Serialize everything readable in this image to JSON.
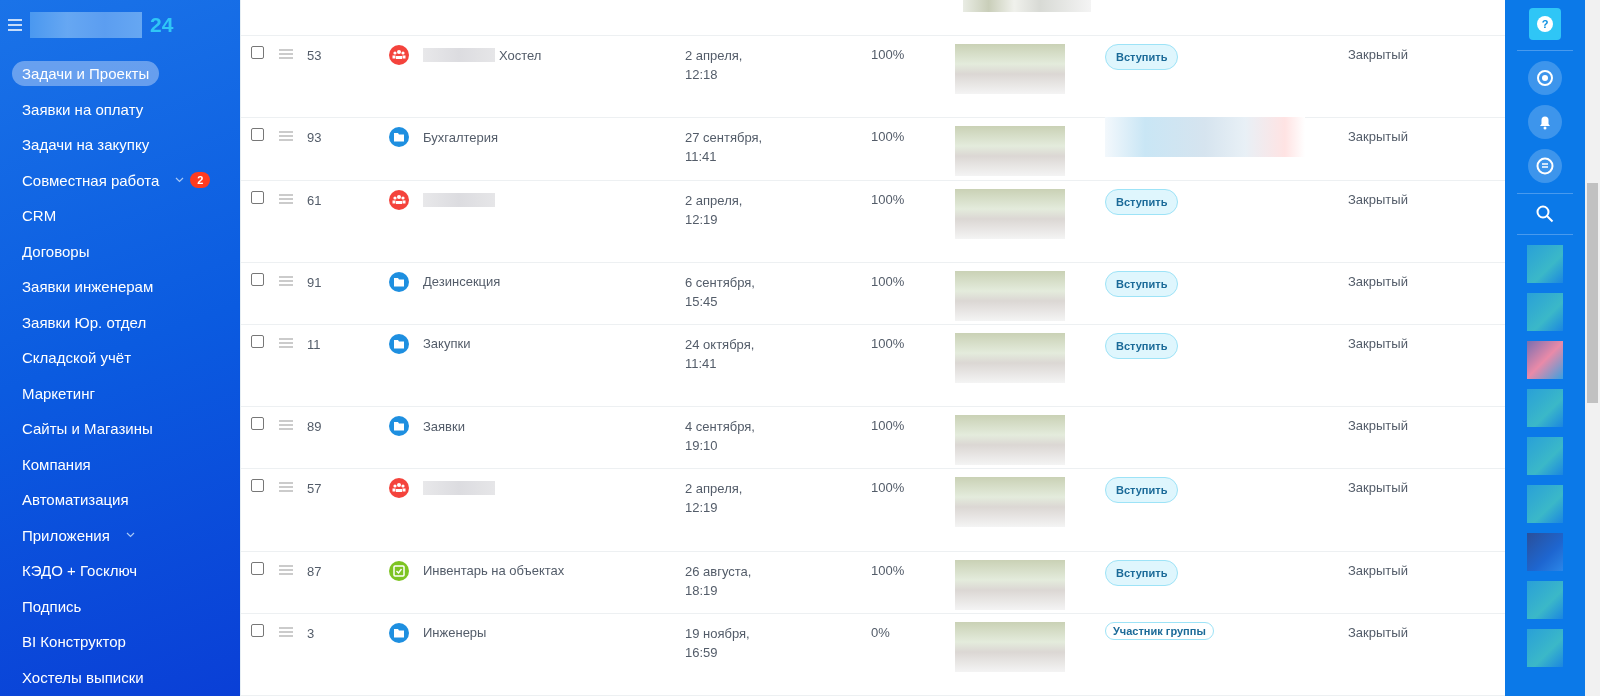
{
  "sidebar": {
    "logo_suffix": "24",
    "items": [
      {
        "label": "Задачи и Проекты",
        "selected": true
      },
      {
        "label": "Заявки на оплату",
        "selected": false
      },
      {
        "label": "Задачи на закупку",
        "selected": false
      },
      {
        "label": "Совместная работа",
        "selected": false,
        "expandable": true,
        "badge": "2"
      },
      {
        "label": "CRM",
        "selected": false
      },
      {
        "label": "Договоры",
        "selected": false
      },
      {
        "label": "Заявки инженерам",
        "selected": false
      },
      {
        "label": "Заявки Юр. отдел",
        "selected": false
      },
      {
        "label": "Складской учёт",
        "selected": false
      },
      {
        "label": "Маркетинг",
        "selected": false
      },
      {
        "label": "Сайты и Магазины",
        "selected": false
      },
      {
        "label": "Компания",
        "selected": false
      },
      {
        "label": "Автоматизация",
        "selected": false
      },
      {
        "label": "Приложения",
        "selected": false,
        "expandable": true
      },
      {
        "label": "КЭДО + Госключ",
        "selected": false
      },
      {
        "label": "Подпись",
        "selected": false
      },
      {
        "label": "BI Конструктор",
        "selected": false
      },
      {
        "label": "Хостелы выписки",
        "selected": false
      }
    ]
  },
  "table": {
    "rows": [
      {
        "checked": false,
        "id": "53",
        "kind": "group",
        "redacted": true,
        "name": "Хостел",
        "date": "2 апреля,",
        "time": "12:18",
        "progress": "100%",
        "action": {
          "kind": "join",
          "label": "Вступить"
        },
        "type": "Закрытый"
      },
      {
        "checked": false,
        "id": "93",
        "kind": "folder",
        "name": "Бухгалтерия",
        "date": "27 сентября,",
        "time": "11:41",
        "progress": "100%",
        "action": {
          "kind": "hidden"
        },
        "type": "Закрытый"
      },
      {
        "checked": false,
        "id": "61",
        "kind": "group",
        "redacted": true,
        "date": "2 апреля,",
        "time": "12:19",
        "progress": "100%",
        "action": {
          "kind": "join",
          "label": "Вступить"
        },
        "type": "Закрытый"
      },
      {
        "checked": false,
        "id": "91",
        "kind": "folder",
        "name": "Дезинсекция",
        "date": "6 сентября,",
        "time": "15:45",
        "progress": "100%",
        "action": {
          "kind": "join",
          "label": "Вступить"
        },
        "type": "Закрытый"
      },
      {
        "checked": false,
        "id": "11",
        "kind": "folder",
        "name": "Закупки",
        "date": "24 октября,",
        "time": "11:41",
        "progress": "100%",
        "action": {
          "kind": "join",
          "label": "Вступить"
        },
        "type": "Закрытый"
      },
      {
        "checked": false,
        "id": "89",
        "kind": "folder",
        "name": "Заявки",
        "date": "4 сентября,",
        "time": "19:10",
        "progress": "100%",
        "type": "Закрытый"
      },
      {
        "checked": false,
        "id": "57",
        "kind": "group",
        "redacted": true,
        "date": "2 апреля,",
        "time": "12:19",
        "progress": "100%",
        "action": {
          "kind": "join",
          "label": "Вступить"
        },
        "type": "Закрытый"
      },
      {
        "checked": false,
        "id": "87",
        "kind": "board",
        "name": "Инвентарь на объектах",
        "date": "26 августа,",
        "time": "18:19",
        "progress": "100%",
        "action": {
          "kind": "join",
          "label": "Вступить"
        },
        "type": "Закрытый"
      },
      {
        "checked": false,
        "id": "3",
        "kind": "folder",
        "name": "Инженеры",
        "date": "19 ноября,",
        "time": "16:59",
        "progress": "0%",
        "action": {
          "kind": "member",
          "label": "Участник группы"
        },
        "type": "Закрытый"
      }
    ]
  },
  "right_bar": {
    "help": "?"
  }
}
